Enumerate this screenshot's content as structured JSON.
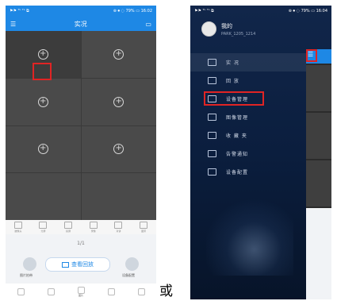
{
  "left_phone": {
    "status": {
      "left": "⚑⚑ ᵀᴸ ᵀᴸ ⧉",
      "right": "⊚ ⏺ ◌ 79% ▭ 16:02"
    },
    "header_title": "实况",
    "toolbar_items": [
      "披像头",
      "分屏",
      "投屏",
      "录像",
      "对讲",
      "图带"
    ],
    "page_indicator": "1/1",
    "playback_button": "查看回放",
    "left_round_label": "图片拍带",
    "right_round_label": "设备配置",
    "nav_items": [
      "",
      "",
      "图片",
      "",
      ""
    ]
  },
  "or_text": "或",
  "right_phone": {
    "status": {
      "left": "⚑⚑ ᵀᴸ ᵀᴸ ⧉",
      "right": "⊚ ⏺ ◌ 79% ▭ 16:04"
    },
    "user_name": "我的",
    "user_sub": "PARK_1205_1214",
    "menu": [
      {
        "label": "实 况",
        "icon": "monitor-icon"
      },
      {
        "label": "回 放",
        "icon": "film-icon"
      },
      {
        "label": "设备管理",
        "icon": "device-icon"
      },
      {
        "label": "图像管理",
        "icon": "folder-icon"
      },
      {
        "label": "收 藏 夹",
        "icon": "star-icon"
      },
      {
        "label": "告警通知",
        "icon": "chat-icon"
      },
      {
        "label": "设备配置",
        "icon": "settings-icon"
      }
    ]
  },
  "colors": {
    "accent": "#1e88e5",
    "highlight": "#e02424",
    "drawer_bg": "#0b1e3e"
  }
}
